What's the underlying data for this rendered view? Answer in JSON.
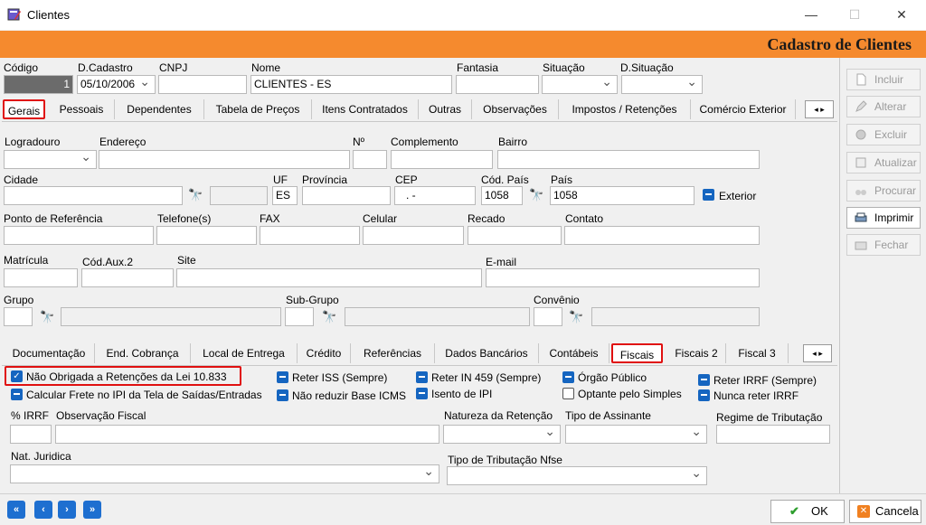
{
  "window": {
    "title": "Clientes",
    "minimize": "—",
    "maximize": "☐",
    "close": "✕"
  },
  "banner": {
    "title": "Cadastro de Clientes"
  },
  "header": {
    "codigo_label": "Código",
    "codigo_value": "1",
    "dcadastro_label": "D.Cadastro",
    "dcadastro_value": "05/10/2006",
    "cnpj_label": "CNPJ",
    "cnpj_value": "",
    "nome_label": "Nome",
    "nome_value": "CLIENTES - ES",
    "fantasia_label": "Fantasia",
    "fantasia_value": "",
    "situacao_label": "Situação",
    "situacao_value": "",
    "dsituacao_label": "D.Situação",
    "dsituacao_value": ""
  },
  "tabs_top": [
    "Gerais",
    "Pessoais",
    "Dependentes",
    "Tabela de Preços",
    "Itens Contratados",
    "Outras",
    "Observações",
    "Impostos / Retenções",
    "Comércio Exterior"
  ],
  "tabs_top_active": "Gerais",
  "scroll_arrows": "◂ ▸",
  "gerais": {
    "logradouro": "Logradouro",
    "endereco": "Endereço",
    "numero": "Nº",
    "complemento": "Complemento",
    "bairro": "Bairro",
    "cidade": "Cidade",
    "uf": "UF",
    "uf_value": "ES",
    "provincia": "Província",
    "cep": "CEP",
    "cep_value": ". -",
    "cod_pais": "Cód. País",
    "cod_pais_value": "1058",
    "pais": "País",
    "pais_value": "1058",
    "exterior": "Exterior",
    "ponto_ref": "Ponto de Referência",
    "telefone": "Telefone(s)",
    "fax": "FAX",
    "celular": "Celular",
    "recado": "Recado",
    "contato": "Contato",
    "matricula": "Matrícula",
    "cod_aux2": "Cód.Aux.2",
    "site": "Site",
    "email": "E-mail",
    "grupo": "Grupo",
    "subgrupo": "Sub-Grupo",
    "convenio": "Convênio"
  },
  "tabs_bottom": [
    "Documentação",
    "End. Cobrança",
    "Local de Entrega",
    "Crédito",
    "Referências",
    "Dados Bancários",
    "Contábeis",
    "Fiscais",
    "Fiscais 2",
    "Fiscal 3"
  ],
  "tabs_bottom_active": "Fiscais",
  "fiscais": {
    "checks": [
      {
        "label": "Não Obrigada a Retenções da Lei  10.833",
        "state": "checked"
      },
      {
        "label": "Reter ISS (Sempre)",
        "state": "mixed"
      },
      {
        "label": "Reter IN 459 (Sempre)",
        "state": "mixed"
      },
      {
        "label": "Órgão Público",
        "state": "mixed"
      },
      {
        "label": "Reter IRRF (Sempre)",
        "state": "mixed"
      },
      {
        "label": "Calcular Frete no IPI da Tela de Saídas/Entradas",
        "state": "mixed"
      },
      {
        "label": "Não reduzir Base ICMS",
        "state": "mixed"
      },
      {
        "label": "Isento de IPI",
        "state": "mixed"
      },
      {
        "label": "Optante pelo Simples",
        "state": "unchecked"
      },
      {
        "label": "Nunca reter IRRF",
        "state": "mixed"
      }
    ],
    "pct_irrf": "% IRRF",
    "obs_fiscal": "Observação Fiscal",
    "natureza_retencao": "Natureza da Retenção",
    "tipo_assinante": "Tipo de Assinante",
    "regime_tributacao": "Regime de Tributação",
    "nat_juridica": "Nat. Juridica",
    "tipo_tributacao_nfse": "Tipo de Tributação Nfse"
  },
  "side_buttons": [
    {
      "label": "Incluir",
      "icon": "new-document-icon",
      "enabled": false
    },
    {
      "label": "Alterar",
      "icon": "edit-icon",
      "enabled": false
    },
    {
      "label": "Excluir",
      "icon": "delete-icon",
      "enabled": false
    },
    {
      "label": "Atualizar",
      "icon": "refresh-icon",
      "enabled": false
    },
    {
      "label": "Procurar",
      "icon": "binoculars-icon",
      "enabled": false
    },
    {
      "label": "Imprimir",
      "icon": "printer-icon",
      "enabled": true
    },
    {
      "label": "Fechar",
      "icon": "close-folder-icon",
      "enabled": false
    }
  ],
  "nav": {
    "first": "«",
    "prev": "‹",
    "next": "›",
    "last": "»"
  },
  "footer": {
    "ok": "OK",
    "cancel": "Cancela"
  },
  "colors": {
    "banner": "#f58a2e",
    "accent": "#1565c0",
    "highlight": "#e01010"
  }
}
